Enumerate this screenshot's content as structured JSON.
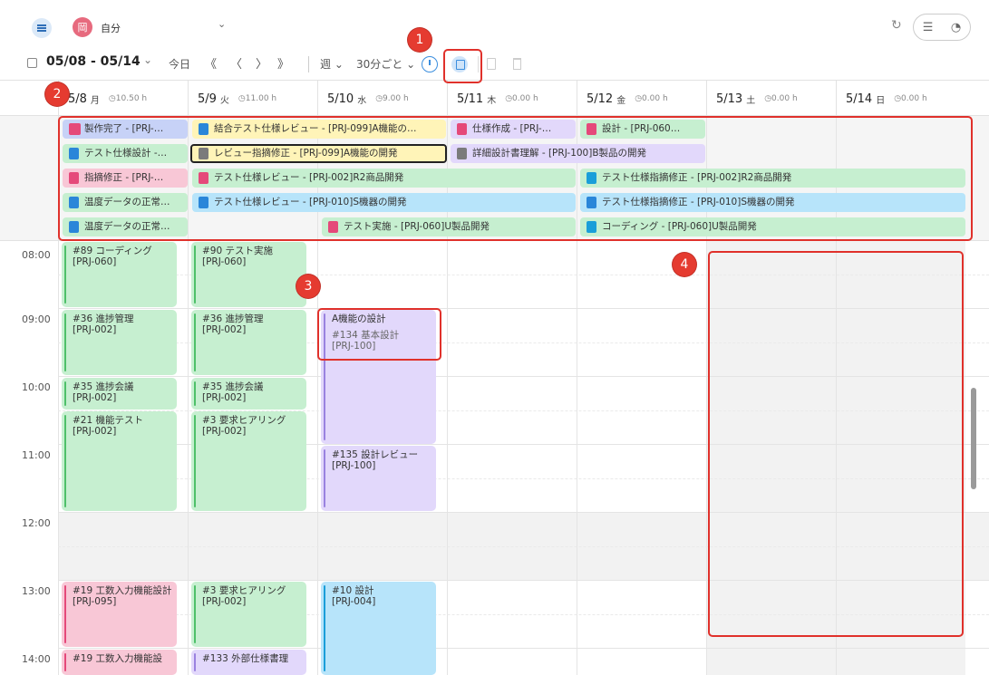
{
  "header": {
    "avatar_text": "岡",
    "user_name": "自分",
    "refresh_icon": "refresh-icon",
    "view_list_icon": "list-icon",
    "view_chart_icon": "pie-chart-icon"
  },
  "toolbar": {
    "date_range": "05/08 - 05/14",
    "range_chevron": "⌄",
    "today_label": "今日",
    "first_label": "《",
    "prev_label": "〈",
    "next_label": "〉",
    "last_label": "》",
    "unit_label": "週 ⌄",
    "interval_label": "30分ごと ⌄"
  },
  "days": [
    {
      "date": "5/8",
      "dow": "月",
      "hours": "◷10.50 h"
    },
    {
      "date": "5/9",
      "dow": "火",
      "hours": "◷11.00 h"
    },
    {
      "date": "5/10",
      "dow": "水",
      "hours": "◷9.00 h"
    },
    {
      "date": "5/11",
      "dow": "木",
      "hours": "◷0.00 h"
    },
    {
      "date": "5/12",
      "dow": "金",
      "hours": "◷0.00 h"
    },
    {
      "date": "5/13",
      "dow": "土",
      "hours": "◷0.00 h"
    },
    {
      "date": "5/14",
      "dow": "日",
      "hours": "◷0.00 h"
    }
  ],
  "allday_events": [
    {
      "label": "製作完了 - [PRJ-…"
    },
    {
      "label": "結合テスト仕様レビュー - [PRJ-099]A機能の…"
    },
    {
      "label": "仕様作成 - [PRJ-…"
    },
    {
      "label": "設計 - [PRJ-060…"
    },
    {
      "label": "テスト仕様設計 -…"
    },
    {
      "label": "レビュー指摘修正 - [PRJ-099]A機能の開発"
    },
    {
      "label": "詳細設計書理解 - [PRJ-100]B製品の開発"
    },
    {
      "label": "指摘修正 - [PRJ-…"
    },
    {
      "label": "テスト仕様レビュー - [PRJ-002]R2商品開発"
    },
    {
      "label": "テスト仕様指摘修正 - [PRJ-002]R2商品開発"
    },
    {
      "label": "温度データの正常…"
    },
    {
      "label": "テスト仕様レビュー - [PRJ-010]S機器の開発"
    },
    {
      "label": "テスト仕様指摘修正 - [PRJ-010]S機器の開発"
    },
    {
      "label": "温度データの正常…"
    },
    {
      "label": "テスト実施 - [PRJ-060]U製品開発"
    },
    {
      "label": "コーディング - [PRJ-060]U製品開発"
    }
  ],
  "times": [
    "08:00",
    "09:00",
    "10:00",
    "11:00",
    "12:00",
    "13:00",
    "14:00"
  ],
  "events": [
    {
      "title": "#89 コーディング",
      "sub": "[PRJ-060]"
    },
    {
      "title": "#90 テスト実施",
      "sub": "[PRJ-060]"
    },
    {
      "title": "#36 進捗管理",
      "sub": "[PRJ-002]"
    },
    {
      "title": "#36 進捗管理",
      "sub": "[PRJ-002]"
    },
    {
      "title": "A機能の設計",
      "sub": "#134 基本設計",
      "sub2": "[PRJ-100]"
    },
    {
      "title": "#35 進捗会議",
      "sub": "[PRJ-002]"
    },
    {
      "title": "#35 進捗会議",
      "sub": "[PRJ-002]"
    },
    {
      "title": "#21 機能テスト",
      "sub": "[PRJ-002]"
    },
    {
      "title": "#3 要求ヒアリング",
      "sub": "[PRJ-002]"
    },
    {
      "title": "#135 設計レビュー",
      "sub": "[PRJ-100]"
    },
    {
      "title": "#19 工数入力機能設計",
      "sub": "[PRJ-095]"
    },
    {
      "title": "#3 要求ヒアリング",
      "sub": "[PRJ-002]"
    },
    {
      "title": "#10 設計",
      "sub": "[PRJ-004]"
    },
    {
      "title": "#19 工数入力機能設",
      "sub": ""
    },
    {
      "title": "#133 外部仕様書理",
      "sub": ""
    }
  ],
  "badges": [
    "1",
    "2",
    "3",
    "4"
  ]
}
